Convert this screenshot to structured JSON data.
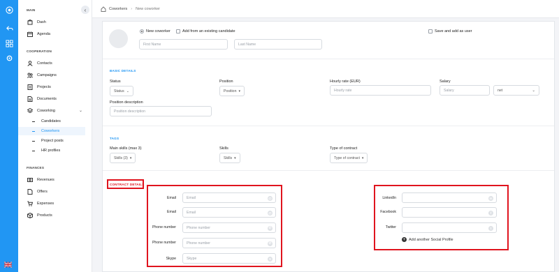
{
  "sidebar": {
    "main_title": "MAIN",
    "cooperation_title": "COOPERATION",
    "finances_title": "FINANCES",
    "items": {
      "dash": "Dash",
      "agenda": "Agenda",
      "contacts": "Contacts",
      "campaigns": "Campaigns",
      "projects": "Projects",
      "documents": "Documents",
      "coworking": "Coworking",
      "candidates": "Candidates",
      "coworkers": "Coworkers",
      "project_posts": "Project posts",
      "hr_profiles": "HR profiles",
      "revenues": "Revenues",
      "offers": "Offers",
      "expenses": "Expenses",
      "products": "Products"
    },
    "collapse_glyph": "‹"
  },
  "breadcrumb": {
    "parent": "Coworkers",
    "separator": "›",
    "current": "New coworker"
  },
  "form": {
    "new_coworker": "New coworker",
    "add_existing": "Add from an existing candidate",
    "save_as_user": "Save and add as user",
    "first_name_placeholder": "First Name",
    "last_name_placeholder": "Last Name",
    "basic": {
      "title": "BASIC DETAILS",
      "status_label": "Status",
      "status_value": "Status",
      "position_label": "Position",
      "position_value": "Position",
      "hourly_label": "Hourly rate (EUR)",
      "hourly_placeholder": "Hourly rate",
      "salary_label": "Salary",
      "salary_placeholder": "Salary",
      "salary_type": "net",
      "position_desc_label": "Position description",
      "position_desc_placeholder": "Position description"
    },
    "tags": {
      "title": "TAGS",
      "main_skills_label": "Main skills (max 3)",
      "main_skills_value": "Skills (3)",
      "skills_label": "Skills",
      "skills_value": "Skills",
      "contract_label": "Type of contract",
      "contract_value": "Type of contract"
    },
    "contract": {
      "title": "CONTRACT DETAILS",
      "rows": [
        {
          "label": "Email",
          "placeholder": "Email",
          "icon": "@"
        },
        {
          "label": "Email",
          "placeholder": "Email",
          "icon": "@"
        },
        {
          "label": "Phone number",
          "placeholder": "Phone number",
          "icon": "✆"
        },
        {
          "label": "Phone number",
          "placeholder": "Phone number",
          "icon": "✆"
        },
        {
          "label": "Skype",
          "placeholder": "Skype",
          "icon": "S"
        }
      ],
      "social": [
        {
          "label": "LinkedIn",
          "icon": "in"
        },
        {
          "label": "Facebook",
          "icon": "f"
        },
        {
          "label": "Twitter",
          "icon": "t"
        }
      ],
      "add_social": "Add another Social Profile"
    }
  },
  "colors": {
    "accent": "#2196f3",
    "highlight": "#e0141e"
  }
}
